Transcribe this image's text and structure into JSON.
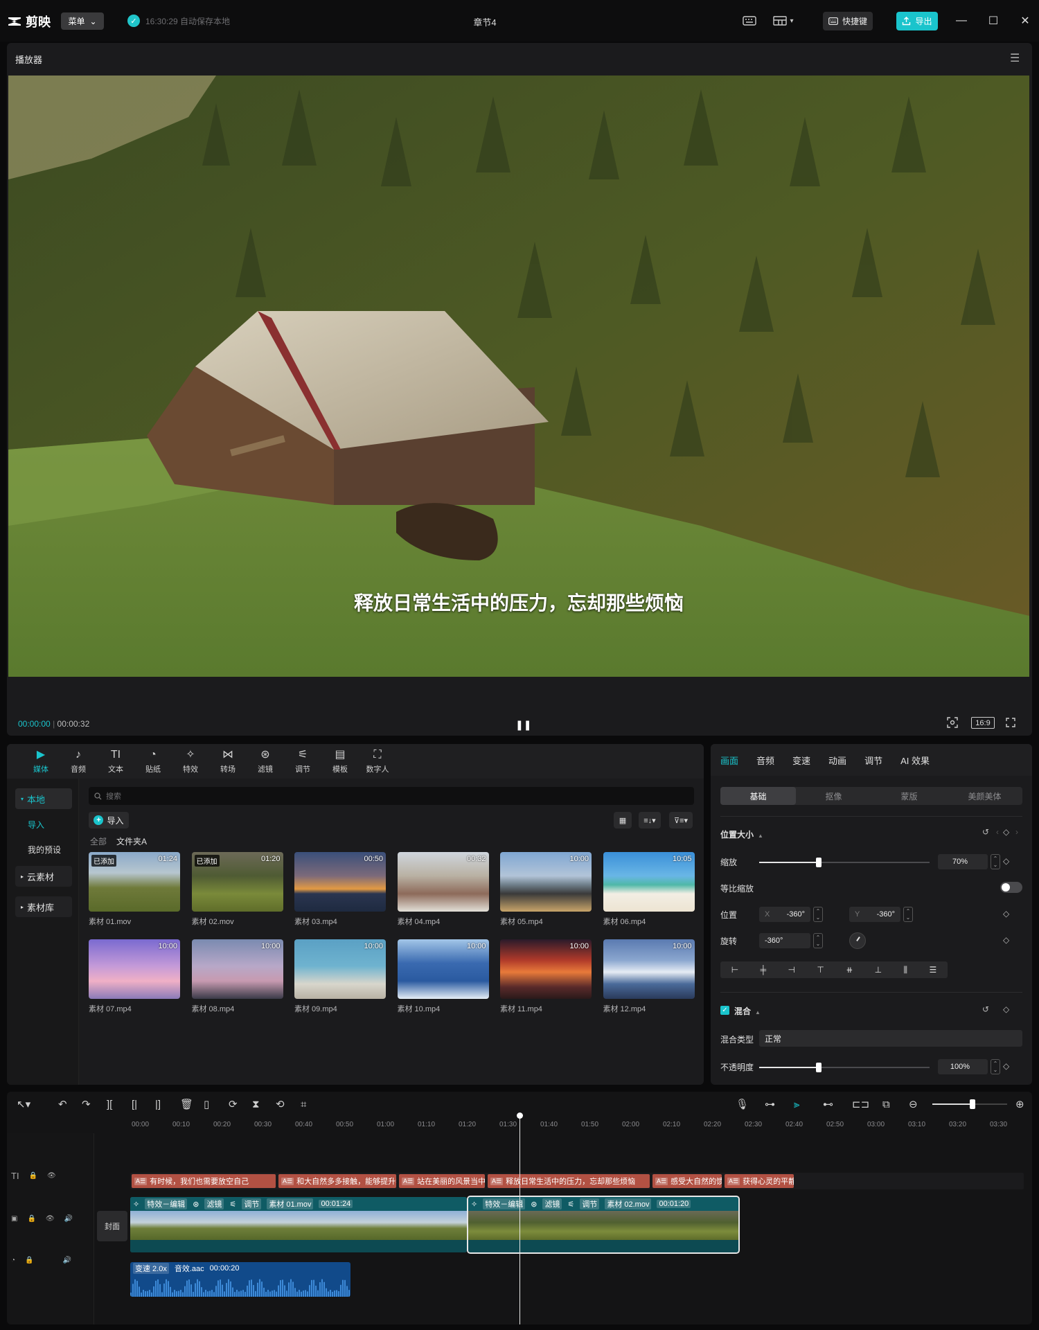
{
  "app": {
    "logo_text": "剪映",
    "menu_label": "菜单",
    "save_status": "16:30:29 自动保存本地",
    "project_title": "章节4",
    "shortcut_label": "快捷键",
    "export_label": "导出",
    "accent": "#1ac4cc"
  },
  "player": {
    "title": "播放器",
    "subtitle": "释放日常生活中的压力，忘却那些烦恼",
    "current_time": "00:00:00",
    "total_time": "00:00:32",
    "ratio": "16:9"
  },
  "media_toolbar": [
    {
      "label": "媒体",
      "icon": "media-icon",
      "glyph": "▶"
    },
    {
      "label": "音频",
      "icon": "audio-icon",
      "glyph": "♪"
    },
    {
      "label": "文本",
      "icon": "text-icon",
      "glyph": "TI"
    },
    {
      "label": "贴纸",
      "icon": "sticker-icon",
      "glyph": "◔"
    },
    {
      "label": "特效",
      "icon": "effects-icon",
      "glyph": "✧"
    },
    {
      "label": "转场",
      "icon": "transition-icon",
      "glyph": "⋈"
    },
    {
      "label": "滤镜",
      "icon": "filter-icon",
      "glyph": "⊛"
    },
    {
      "label": "调节",
      "icon": "adjust-icon",
      "glyph": "⚟"
    },
    {
      "label": "模板",
      "icon": "template-icon",
      "glyph": "▤"
    },
    {
      "label": "数字人",
      "icon": "digital-human-icon",
      "glyph": "⛶"
    }
  ],
  "media_side": {
    "local": "本地",
    "import": "导入",
    "presets": "我的预设",
    "cloud": "云素材",
    "library": "素材库"
  },
  "media": {
    "search_placeholder": "搜索",
    "import_label": "导入",
    "crumb_all": "全部",
    "crumb_folder": "文件夹A",
    "items": [
      {
        "name": "素材 01.mov",
        "badge": "已添加",
        "duration": "01:24",
        "thumb": "linear-gradient(180deg,#8aa9c9 0%,#b7c6cf 35%,#6f7a3a 60%,#5a6a2a 100%)"
      },
      {
        "name": "素材 02.mov",
        "badge": "已添加",
        "duration": "01:20",
        "thumb": "linear-gradient(180deg,#6d6a58 0%,#4f5b33 40%,#7a8a3a 70%,#5f6d2a 100%)"
      },
      {
        "name": "素材 03.mp4",
        "badge": "",
        "duration": "00:50",
        "thumb": "linear-gradient(180deg,#3a4f7a 0%,#7c6a7a 40%,#e39a43 62%,#2a3550 70%,#1e2a40 100%)"
      },
      {
        "name": "素材 04.mp4",
        "badge": "",
        "duration": "00:32",
        "thumb": "linear-gradient(180deg,#cfd6dd 0%,#b9b1a3 40%,#8d6a5a 70%,#e3e0d8 100%)"
      },
      {
        "name": "素材 05.mp4",
        "badge": "",
        "duration": "10:00",
        "thumb": "linear-gradient(180deg,#7fa6d2 0%,#b2c4d8 40%,#6f7f8a 55%,#3a3a3a 70%,#c9a56a 100%)"
      },
      {
        "name": "素材 06.mp4",
        "badge": "",
        "duration": "10:05",
        "thumb": "linear-gradient(180deg,#3a8fd8 0%,#69b6e6 40%,#4fb8a8 55%,#f2eee4 70%,#ede4d2 100%)"
      },
      {
        "name": "素材 07.mp4",
        "badge": "",
        "duration": "10:00",
        "thumb": "linear-gradient(180deg,#7a6ad0 0%,#c49ad8 45%,#f0b0c6 70%,#8a7ab8 100%)"
      },
      {
        "name": "素材 08.mp4",
        "badge": "",
        "duration": "10:00",
        "thumb": "linear-gradient(180deg,#7a8ab0 0%,#b7a8c8 45%,#c79ab0 70%,#3a3a48 100%)"
      },
      {
        "name": "素材 09.mp4",
        "badge": "",
        "duration": "10:00",
        "thumb": "linear-gradient(180deg,#5aa0c4 0%,#6fb3cf 45%,#d8d6cc 75%,#b8b2a4 100%)"
      },
      {
        "name": "素材 10.mp4",
        "badge": "",
        "duration": "10:00",
        "thumb": "linear-gradient(180deg,#a3c6e8 0%,#3a6ab0 40%,#2a5aa0 70%,#e6eef6 100%)"
      },
      {
        "name": "素材 11.mp4",
        "badge": "",
        "duration": "10:00",
        "thumb": "linear-gradient(180deg,#2a1a2a 0%,#b03a2a 35%,#e87a3a 55%,#5a2a2a 80%,#2a1a1a 100%)"
      },
      {
        "name": "素材 12.mp4",
        "badge": "",
        "duration": "10:00",
        "thumb": "linear-gradient(180deg,#5a7ab0 0%,#8aa6cf 35%,#e6ecf4 55%,#4a6a9a 75%,#2a3a5a 100%)"
      }
    ]
  },
  "props": {
    "tabs": [
      "画面",
      "音频",
      "变速",
      "动画",
      "调节",
      "AI 效果"
    ],
    "sub_tabs": [
      "基础",
      "抠像",
      "蒙版",
      "美颜美体"
    ],
    "section_pos": "位置大小",
    "scale_label": "缩放",
    "scale_value": "70%",
    "scale_fraction": 0.35,
    "uniform_label": "等比缩放",
    "uniform_on": false,
    "position_label": "位置",
    "x_label": "X",
    "x_value": "-360°",
    "y_label": "Y",
    "y_value": "-360°",
    "rotation_label": "旋转",
    "rotation_value": "-360°",
    "section_blend": "混合",
    "blend_type_label": "混合类型",
    "blend_type_value": "正常",
    "opacity_label": "不透明度",
    "opacity_value": "100%",
    "opacity_fraction": 0.35
  },
  "timeline": {
    "ruler": [
      "00:00",
      "00:10",
      "00:20",
      "00:30",
      "00:40",
      "00:50",
      "01:00",
      "01:10",
      "01:20",
      "01:30",
      "01:40",
      "01:50",
      "02:00",
      "02:10",
      "02:20",
      "02:30",
      "02:40",
      "02:50",
      "03:00",
      "03:10",
      "03:20",
      "03:30"
    ],
    "cover_label": "封面",
    "text_clips": [
      {
        "text": "有时候，我们也需要放空自己",
        "w": 208
      },
      {
        "text": "和大自然多多接触，能够提升我",
        "w": 170
      },
      {
        "text": "站在美丽的风景当中",
        "w": 124
      },
      {
        "text": "释放日常生活中的压力，忘却那些烦恼",
        "w": 234
      },
      {
        "text": "感受大自然的馈",
        "w": 100
      },
      {
        "text": "获得心灵的平静",
        "w": 100
      }
    ],
    "video_clips": [
      {
        "effect": "特效－编辑",
        "filter": "滤镜",
        "adjust": "调节",
        "name": "素材 01.mov",
        "duration": "00:01:24"
      },
      {
        "effect": "特效－编辑",
        "filter": "滤镜",
        "adjust": "调节",
        "name": "素材 02.mov",
        "duration": "00:01:20"
      }
    ],
    "audio_clip": {
      "speed": "变速 2.0x",
      "name": "音效.aac",
      "duration": "00:00:20"
    }
  }
}
